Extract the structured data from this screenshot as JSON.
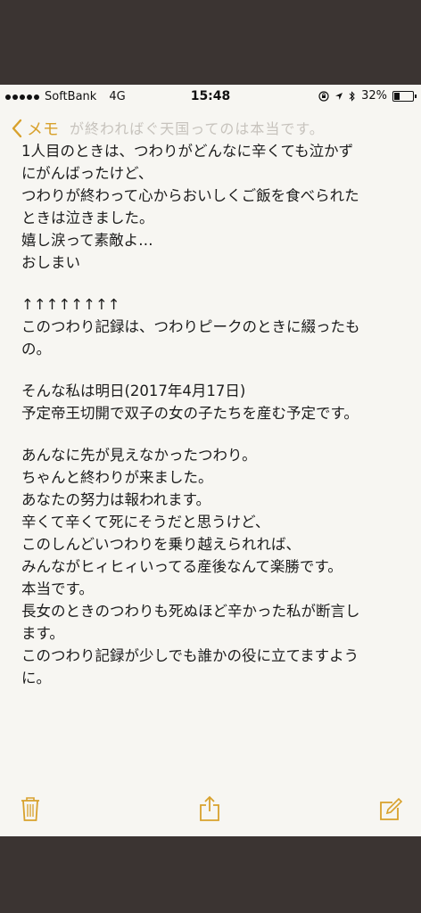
{
  "status": {
    "carrier": "SoftBank",
    "network": "4G",
    "time": "15:48",
    "battery": "32%"
  },
  "nav": {
    "back_label": "メモ",
    "ghost_title": "が終わればぐ天国ってのは本当です。"
  },
  "note": {
    "lines": [
      "1人目のときは、つわりがどんなに辛くても泣かず",
      "にがんばったけど、",
      "つわりが終わって心からおいしくご飯を食べられた",
      "ときは泣きました。",
      "嬉し涙って素敵よ…",
      "おしまい",
      "",
      "↑↑↑↑↑↑↑↑",
      "このつわり記録は、つわりピークのときに綴ったも",
      "の。",
      "",
      "そんな私は明日(2017年4月17日)",
      "予定帝王切開で双子の女の子たちを産む予定です。",
      "",
      "あんなに先が見えなかったつわり。",
      "ちゃんと終わりが来ました。",
      "あなたの努力は報われます。",
      "辛くて辛くて死にそうだと思うけど、",
      "このしんどいつわりを乗り越えられれば、",
      "みんながヒィヒィいってる産後なんて楽勝です。",
      "本当です。",
      "長女のときのつわりも死ぬほど辛かった私が断言し",
      "ます。",
      "このつわり記録が少しでも誰かの役に立てますよう",
      "に。"
    ]
  },
  "toolbar": {
    "trash_icon": "trash-icon",
    "share_icon": "share-icon",
    "compose_icon": "compose-icon"
  },
  "colors": {
    "accent": "#d8a12c",
    "paper": "#f7f6f2",
    "frame": "#3b3432"
  }
}
